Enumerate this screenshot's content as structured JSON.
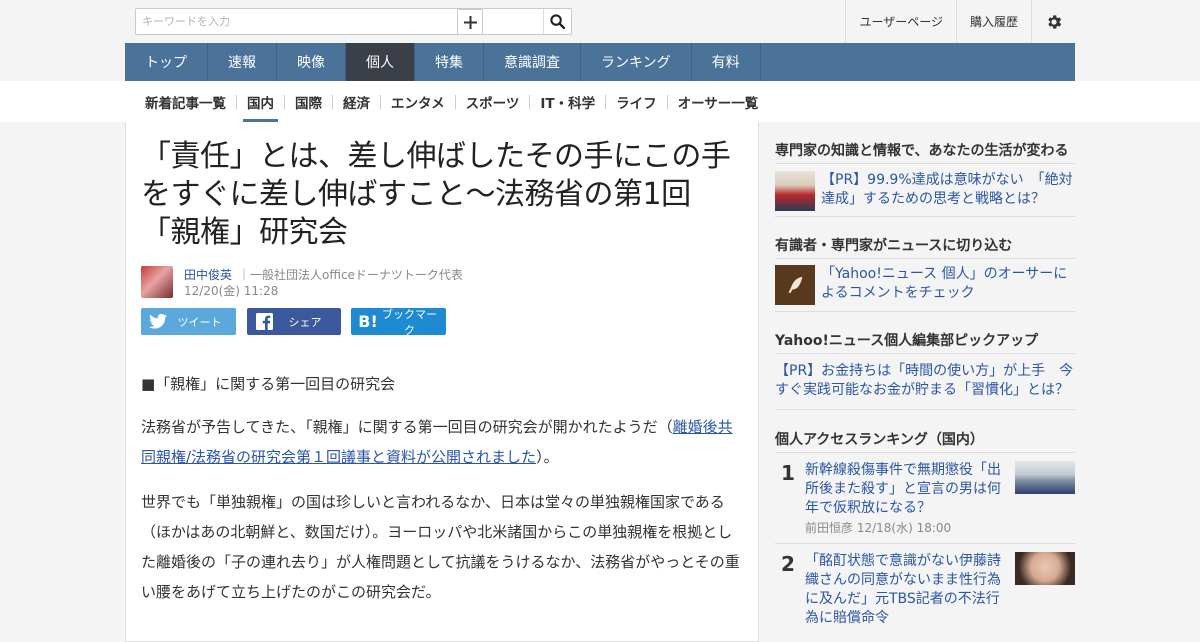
{
  "search": {
    "placeholder": "キーワードを入力",
    "search_icon": "search-icon",
    "add_icon": "plus-icon"
  },
  "top_links": {
    "user_page": "ユーザーページ",
    "purchase_history": "購入履歴",
    "settings_icon": "gear-icon"
  },
  "main_nav": [
    {
      "label": "トップ"
    },
    {
      "label": "速報"
    },
    {
      "label": "映像"
    },
    {
      "label": "個人",
      "active": true
    },
    {
      "label": "特集"
    },
    {
      "label": "意識調査"
    },
    {
      "label": "ランキング"
    },
    {
      "label": "有料"
    }
  ],
  "sub_nav": [
    {
      "label": "新着記事一覧"
    },
    {
      "label": "国内",
      "active": true
    },
    {
      "label": "国際"
    },
    {
      "label": "経済"
    },
    {
      "label": "エンタメ"
    },
    {
      "label": "スポーツ"
    },
    {
      "label": "IT・科学"
    },
    {
      "label": "ライフ"
    },
    {
      "label": "オーサー一覧"
    }
  ],
  "article": {
    "title": "「責任」とは、差し伸ばしたその手にこの手をすぐに差し伸ばすこと～法務省の第1回「親権」研究会",
    "author": {
      "name": "田中俊英",
      "organization": "｜一般社団法人officeドーナツトーク代表"
    },
    "date": "12/20(金) 11:28",
    "share": {
      "tweet": "ツイート",
      "share": "シェア",
      "bookmark": "ブックマーク"
    },
    "paragraphs": {
      "p1": "■「親権」に関する第一回目の研究会",
      "p2_before": "法務省が予告してきた、「親権」に関する第一回目の研究会が開かれたようだ（",
      "p2_link": "離婚後共同親権/法務省の研究会第１回議事と資料が公開されました",
      "p2_after": "）。",
      "p3": "世界でも「単独親権」の国は珍しいと言われるなか、日本は堂々の単独親権国家である（ほかはあの北朝鮮と、数国だけ）。ヨーロッパや北米諸国からこの単独親権を根拠とした離婚後の「子の連れ去り」が人権問題として抗議をうけるなか、法務省がやっとその重い腰をあげて立ち上げたのがこの研究会だ。"
    }
  },
  "sidebar": {
    "section1": {
      "heading": "専門家の知識と情報で、あなたの生活が変わる",
      "item": "【PR】99.9%達成は意味がない　「絶対達成」するための思考と戦略とは？"
    },
    "section2": {
      "heading": "有識者・専門家がニュースに切り込む",
      "item": "「Yahoo!ニュース 個人」のオーサーによるコメントをチェック"
    },
    "section3": {
      "heading": "Yahoo!ニュース個人編集部ピックアップ",
      "item": "【PR】お金持ちは「時間の使い方」が上手　今すぐ実践可能なお金が貯まる「習慣化」とは？"
    },
    "ranking": {
      "heading": "個人アクセスランキング（国内）",
      "items": [
        {
          "rank": "1",
          "title": "新幹線殺傷事件で無期懲役「出所後また殺す」と宣言の男は何年で仮釈放になる？",
          "meta": "前田恒彦 12/18(水) 18:00"
        },
        {
          "rank": "2",
          "title": "「酩酊状態で意識がない伊藤詩織さんの同意がないまま性行為に及んだ」元TBS記者の不法行為に賠償命令",
          "meta": ""
        }
      ]
    }
  },
  "colors": {
    "nav_bg": "#4b7299",
    "nav_active": "#3a3f48",
    "link": "#2a56a8",
    "twitter": "#5ba8dd",
    "facebook": "#3a589b",
    "hatena": "#1e8ad2"
  }
}
